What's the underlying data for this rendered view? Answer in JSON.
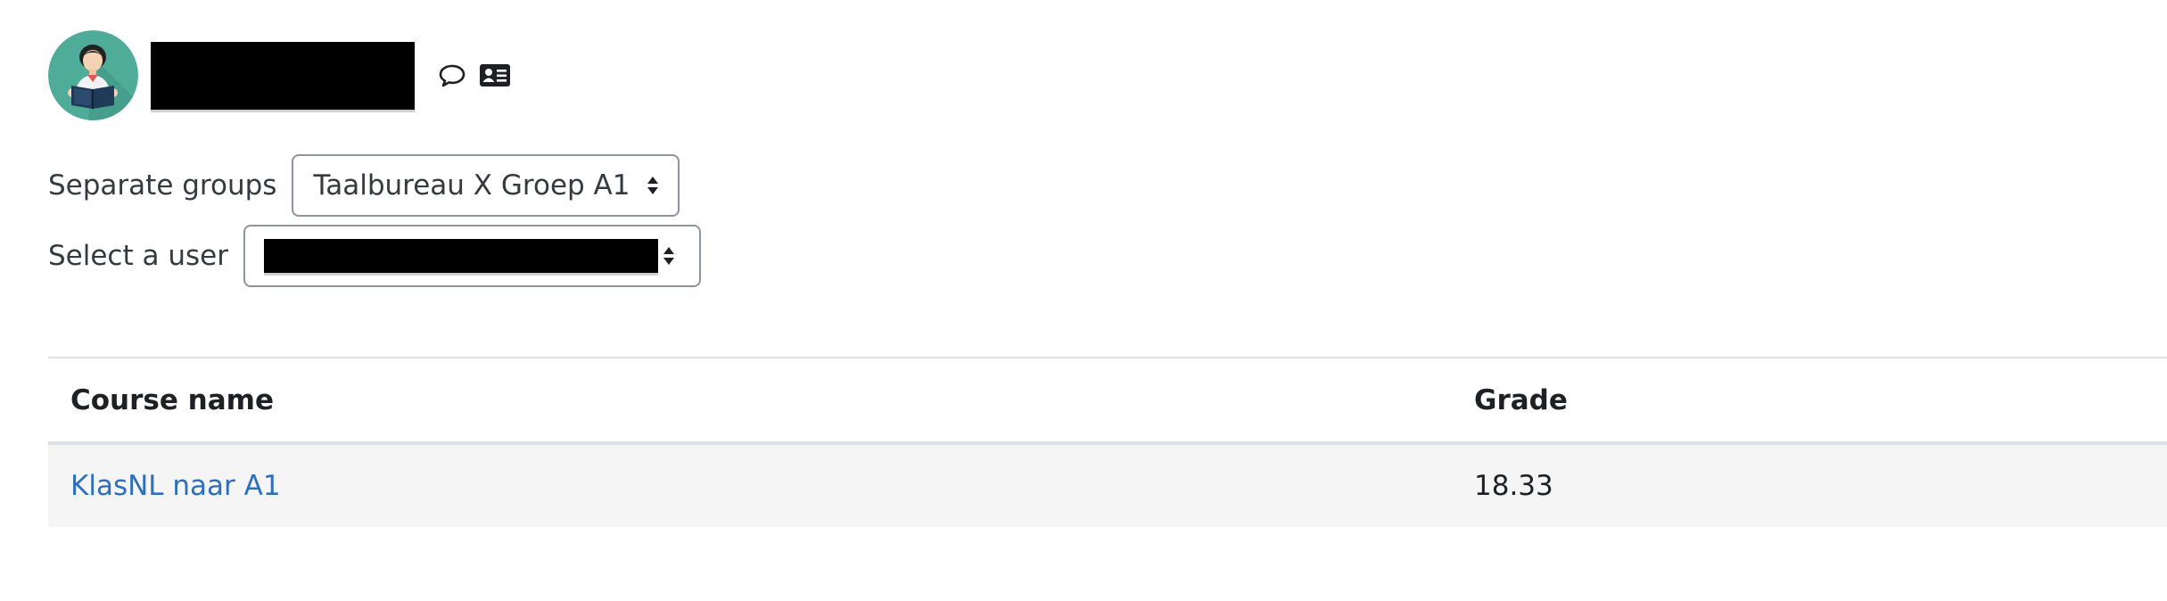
{
  "header": {
    "avatar_icon": "reading-student-avatar",
    "message_icon": "speech-bubble-icon",
    "profile_icon": "address-card-icon"
  },
  "filters": {
    "groups_label": "Separate groups",
    "groups_selected": "Taalbureau X Groep A1",
    "user_label": "Select a user"
  },
  "table": {
    "columns": [
      "Course name",
      "Grade"
    ],
    "rows": [
      {
        "course": "KlasNL naar A1",
        "grade": "18.33"
      }
    ]
  },
  "colors": {
    "link": "#2e6fbd",
    "row_background": "#f5f5f5",
    "avatar_background": "#4eac98"
  }
}
